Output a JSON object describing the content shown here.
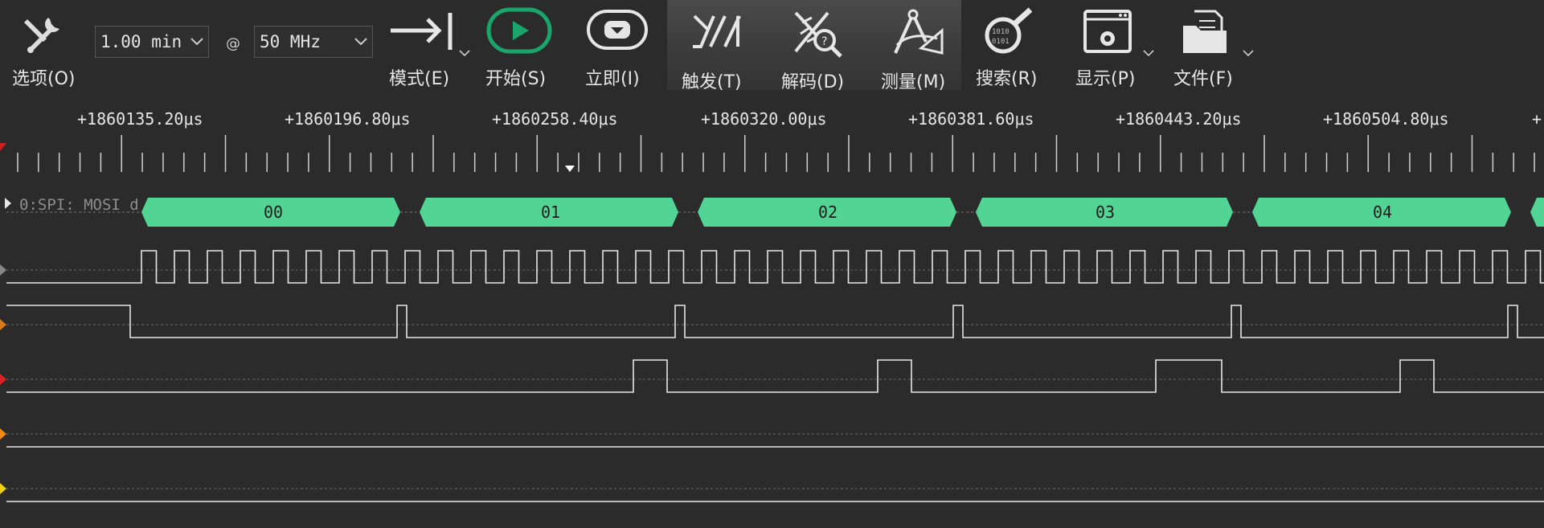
{
  "toolbar": {
    "options": {
      "label": "选项(O)",
      "icon": "wrench-screwdriver-icon"
    },
    "duration": {
      "value": "1.00 min"
    },
    "at_symbol": "@",
    "sample_rate": {
      "value": "50 MHz"
    },
    "mode": {
      "label": "模式(E)",
      "icon": "arrow-to-bar-icon"
    },
    "start": {
      "label": "开始(S)",
      "icon": "play-icon",
      "color": "#1aa56a"
    },
    "instant": {
      "label": "立即(I)",
      "icon": "instant-capture-icon"
    },
    "trigger": {
      "label": "触发(T)",
      "icon": "trigger-icon"
    },
    "decode": {
      "label": "解码(D)",
      "icon": "decode-icon"
    },
    "measure": {
      "label": "测量(M)",
      "icon": "measure-icon"
    },
    "search": {
      "label": "搜索(R)",
      "icon": "search-icon"
    },
    "display": {
      "label": "显示(P)",
      "icon": "display-icon"
    },
    "file": {
      "label": "文件(F)",
      "icon": "file-icon"
    }
  },
  "timeline": {
    "labels": [
      "+1860135.20μs",
      "+1860196.80μs",
      "+1860258.40μs",
      "+1860320.00μs",
      "+1860381.60μs",
      "+1860443.20μs",
      "+1860504.80μs",
      "+"
    ],
    "marker_color": "#ffffff"
  },
  "decoder": {
    "name": "0:SPI: MOSI d",
    "segment_color": "#52d494",
    "segments": [
      "00",
      "01",
      "02",
      "03",
      "04"
    ]
  },
  "channel_colors": [
    "#888888",
    "#d67a1a",
    "#e02020",
    "#f08a10",
    "#f0d010"
  ]
}
